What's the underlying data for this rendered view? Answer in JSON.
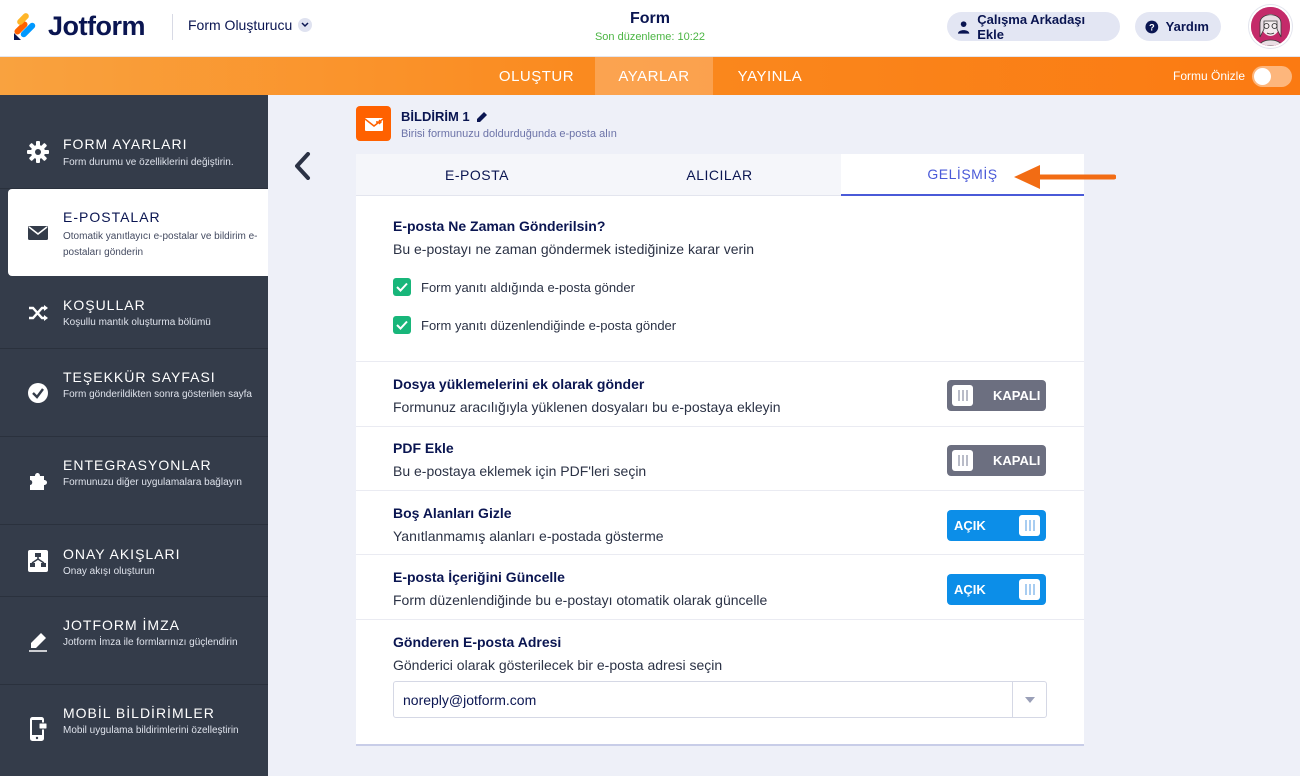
{
  "header": {
    "logo_text": "Jotform",
    "builder_label": "Form Oluşturucu",
    "form_name": "Form",
    "last_edit": "Son düzenleme: 10:22",
    "add_collaborator": "Çalışma Arkadaşı Ekle",
    "help": "Yardım"
  },
  "nav": {
    "tabs": [
      "OLUŞTUR",
      "AYARLAR",
      "YAYINLA"
    ],
    "active_tab": "AYARLAR",
    "preview_label": "Formu Önizle",
    "preview_enabled": false
  },
  "sidebar": {
    "items": [
      {
        "title": "FORM AYARLARI",
        "desc": "Form durumu ve özelliklerini değiştirin.",
        "icon": "gear-icon"
      },
      {
        "title": "E-POSTALAR",
        "desc": "Otomatik yanıtlayıcı e-postalar ve bildirim e-postaları gönderin",
        "icon": "envelope-icon",
        "active": true
      },
      {
        "title": "KOŞULLAR",
        "desc": "Koşullu mantık oluşturma bölümü",
        "icon": "shuffle-icon"
      },
      {
        "title": "TEŞEKKÜR SAYFASI",
        "desc": "Form gönderildikten sonra gösterilen sayfa",
        "icon": "check-circle-icon"
      },
      {
        "title": "ENTEGRASYONLAR",
        "desc": "Formunuzu diğer uygulamalara bağlayın",
        "icon": "puzzle-icon"
      },
      {
        "title": "ONAY AKIŞLARI",
        "desc": "Onay akışı oluşturun",
        "icon": "flow-icon"
      },
      {
        "title": "JOTFORM İMZA",
        "desc": "Jotform İmza ile formlarınızı güçlendirin",
        "icon": "pen-icon"
      },
      {
        "title": "MOBİL BİLDİRİMLER",
        "desc": "Mobil uygulama bildirimlerini özelleştirin",
        "icon": "mobile-icon"
      }
    ]
  },
  "notification": {
    "title": "BİLDİRİM 1",
    "subtitle": "Birisi formunuzu doldurduğunda e-posta alın"
  },
  "tabs": {
    "items": [
      "E-POSTA",
      "ALICILAR",
      "GELİŞMİŞ"
    ],
    "active": "GELİŞMİŞ"
  },
  "settings": {
    "when_title": "E-posta Ne Zaman Gönderilsin?",
    "when_desc": "Bu e-postayı ne zaman göndermek istediğinize karar verin",
    "checkbox_1": "Form yanıtı aldığında e-posta gönder",
    "checkbox_1_checked": true,
    "checkbox_2": "Form yanıtı düzenlendiğinde e-posta gönder",
    "checkbox_2_checked": true,
    "attach_title": "Dosya yüklemelerini ek olarak gönder",
    "attach_desc": "Formunuz aracılığıyla yüklenen dosyaları bu e-postaya ekleyin",
    "attach_state": "KAPALI",
    "pdf_title": "PDF Ekle",
    "pdf_desc": "Bu e-postaya eklemek için PDF'leri seçin",
    "pdf_state": "KAPALI",
    "hide_title": "Boş Alanları Gizle",
    "hide_desc": "Yanıtlanmamış alanları e-postada gösterme",
    "hide_state": "AÇIK",
    "update_title": "E-posta İçeriğini Güncelle",
    "update_desc": "Form düzenlendiğinde bu e-postayı otomatik olarak güncelle",
    "update_state": "AÇIK",
    "sender_title": "Gönderen E-posta Adresi",
    "sender_desc": "Gönderici olarak gösterilecek bir e-posta adresi seçin",
    "sender_value": "noreply@jotform.com"
  },
  "colors": {
    "accent_orange": "#fa8a1f",
    "toggle_on": "#0c8ee8",
    "toggle_off": "#6c6f80",
    "checkbox_green": "#18b67a",
    "sidebar_bg": "#343c4a",
    "active_tab": "#4a5ad8"
  }
}
